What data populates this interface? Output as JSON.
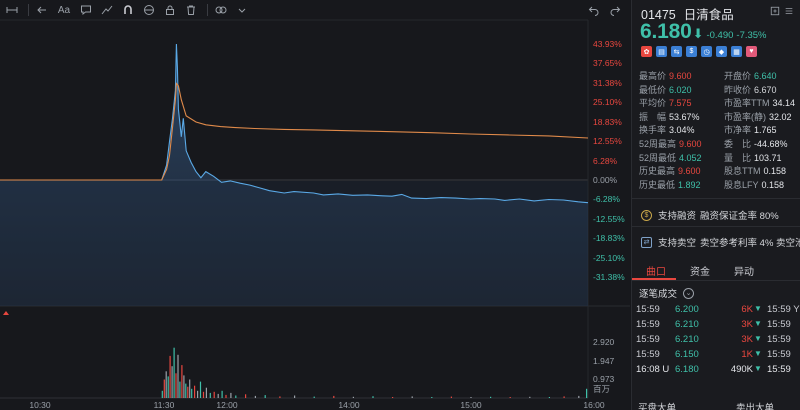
{
  "header": {
    "code": "01475",
    "name": "日清食品",
    "price": "6.180",
    "change": "-0.490",
    "change_pct": "-7.35%"
  },
  "stats": [
    [
      {
        "k": "最高价",
        "v": "9.600",
        "c": "red"
      },
      {
        "k": "开盘价",
        "v": "6.640",
        "c": "green"
      }
    ],
    [
      {
        "k": "最低价",
        "v": "6.020",
        "c": "green"
      },
      {
        "k": "昨收价",
        "v": "6.670",
        "c": ""
      }
    ],
    [
      {
        "k": "平均价",
        "v": "7.575",
        "c": "red"
      },
      {
        "k": "市盈率TTM",
        "v": "34.14",
        "c": "white"
      }
    ],
    [
      {
        "k": "振　幅",
        "v": "53.67%",
        "c": "white"
      },
      {
        "k": "市盈率(静)",
        "v": "32.02",
        "c": "white"
      }
    ],
    [
      {
        "k": "换手率",
        "v": "3.04%",
        "c": "white"
      },
      {
        "k": "市净率",
        "v": "1.765",
        "c": "white"
      }
    ],
    [
      {
        "k": "52周最高",
        "v": "9.600",
        "c": "red"
      },
      {
        "k": "委　比",
        "v": "-44.68%",
        "c": "white"
      }
    ],
    [
      {
        "k": "52周最低",
        "v": "4.052",
        "c": "green"
      },
      {
        "k": "量　比",
        "v": "103.71",
        "c": "white"
      }
    ],
    [
      {
        "k": "历史最高",
        "v": "9.600",
        "c": "red"
      },
      {
        "k": "股息TTM",
        "v": "0.158",
        "c": "white"
      }
    ],
    [
      {
        "k": "历史最低",
        "v": "1.892",
        "c": "green"
      },
      {
        "k": "股息LFY",
        "v": "0.158",
        "c": "white"
      }
    ]
  ],
  "notices": [
    {
      "label": "支持融资",
      "detail": "融资保证金率 80%"
    },
    {
      "label": "支持卖空",
      "detail": "卖空参考利率 4% 卖空池"
    }
  ],
  "tabs": [
    "曲口",
    "资金",
    "异动"
  ],
  "ticks_title": "逐笔成交",
  "ticks": [
    {
      "time": "15:59",
      "price": "6.200",
      "pc": "green",
      "vol": "6K",
      "dir": "down",
      "time2": "15:59 Y"
    },
    {
      "time": "15:59",
      "price": "6.210",
      "pc": "green",
      "vol": "3K",
      "dir": "down",
      "time2": "15:59"
    },
    {
      "time": "15:59",
      "price": "6.210",
      "pc": "green",
      "vol": "3K",
      "dir": "down",
      "time2": "15:59"
    },
    {
      "time": "15:59",
      "price": "6.150",
      "pc": "green",
      "vol": "1K",
      "dir": "down",
      "time2": "15:59"
    },
    {
      "time": "16:08 U",
      "price": "6.180",
      "pc": "green",
      "vol": "490K",
      "dir": "down",
      "time2": "15:59"
    }
  ],
  "footer": {
    "left": "买盘大单",
    "right": "卖出大单"
  },
  "chart_data": {
    "type": "line",
    "title": "",
    "xlabel": "",
    "ylabel": "",
    "x_ticks": [
      "10:30",
      "11:30",
      "12:00",
      "14:00",
      "15:00",
      "16:00"
    ],
    "y_pct_ticks": [
      "43.93%",
      "37.65%",
      "31.38%",
      "25.10%",
      "18.83%",
      "12.55%",
      "6.28%",
      "0.00%",
      "-6.28%",
      "-12.55%",
      "-18.83%",
      "-25.10%",
      "-31.38%"
    ],
    "prev_close": 6.67,
    "series": [
      {
        "key": "price",
        "color": "#5aa9e6",
        "x_minutes": [
          0,
          90,
          115,
          150,
          162,
          165,
          170,
          173,
          176,
          179,
          180,
          181,
          182,
          185,
          187,
          190,
          195,
          200,
          205,
          210,
          218,
          226,
          235,
          245,
          255,
          265,
          275,
          290,
          300,
          320,
          330,
          345,
          360,
          375,
          390,
          400,
          410,
          420,
          435,
          450,
          465,
          480,
          490,
          505,
          515,
          530,
          545,
          560,
          575,
          590,
          600
        ],
        "values": [
          6.67,
          6.67,
          6.67,
          6.67,
          6.67,
          6.67,
          6.99,
          7.5,
          8.0,
          8.6,
          9.6,
          9.1,
          8.2,
          7.6,
          8.0,
          7.3,
          7.05,
          6.85,
          6.72,
          6.85,
          6.75,
          6.62,
          6.65,
          6.6,
          6.56,
          6.5,
          6.44,
          6.39,
          6.42,
          6.39,
          6.35,
          6.37,
          6.34,
          6.35,
          6.33,
          6.32,
          6.36,
          6.28,
          6.27,
          6.29,
          6.28,
          6.26,
          6.27,
          6.26,
          6.23,
          6.26,
          6.22,
          6.25,
          6.24,
          6.2,
          6.18
        ]
      },
      {
        "key": "avg",
        "color": "#e08a4a",
        "x_minutes": [
          0,
          165,
          170,
          173,
          176,
          179,
          180,
          182,
          185,
          190,
          200,
          210,
          225,
          240,
          260,
          290,
          320,
          360,
          400,
          440,
          480,
          520,
          560,
          600
        ],
        "values": [
          6.67,
          6.67,
          6.9,
          7.2,
          7.8,
          8.4,
          8.75,
          8.7,
          8.4,
          8.05,
          7.92,
          7.86,
          7.82,
          7.8,
          7.78,
          7.76,
          7.75,
          7.73,
          7.71,
          7.69,
          7.66,
          7.64,
          7.62,
          7.575
        ]
      }
    ],
    "volume": {
      "unit": "百万",
      "ticks": [
        "2.920",
        "1.947",
        "0.973"
      ],
      "max": 2.92,
      "x_minutes": [
        165,
        167,
        169,
        171,
        173,
        175,
        177,
        179,
        181,
        183,
        185,
        187,
        189,
        191,
        193,
        195,
        198,
        201,
        204,
        207,
        210,
        214,
        218,
        222,
        226,
        230,
        235,
        240,
        250,
        260,
        270,
        285,
        300,
        320,
        340,
        360,
        380,
        400,
        420,
        440,
        460,
        480,
        500,
        520,
        540,
        560,
        575,
        590,
        598
      ],
      "values": [
        0.35,
        0.9,
        1.3,
        1.05,
        2.05,
        1.55,
        2.45,
        1.2,
        2.1,
        0.8,
        1.6,
        1.1,
        0.7,
        0.55,
        0.9,
        0.45,
        0.6,
        0.35,
        0.8,
        0.3,
        0.5,
        0.25,
        0.3,
        0.2,
        0.35,
        0.15,
        0.25,
        0.12,
        0.18,
        0.1,
        0.14,
        0.08,
        0.12,
        0.07,
        0.1,
        0.06,
        0.09,
        0.05,
        0.08,
        0.05,
        0.07,
        0.05,
        0.06,
        0.05,
        0.06,
        0.05,
        0.08,
        0.1,
        0.45
      ]
    }
  }
}
